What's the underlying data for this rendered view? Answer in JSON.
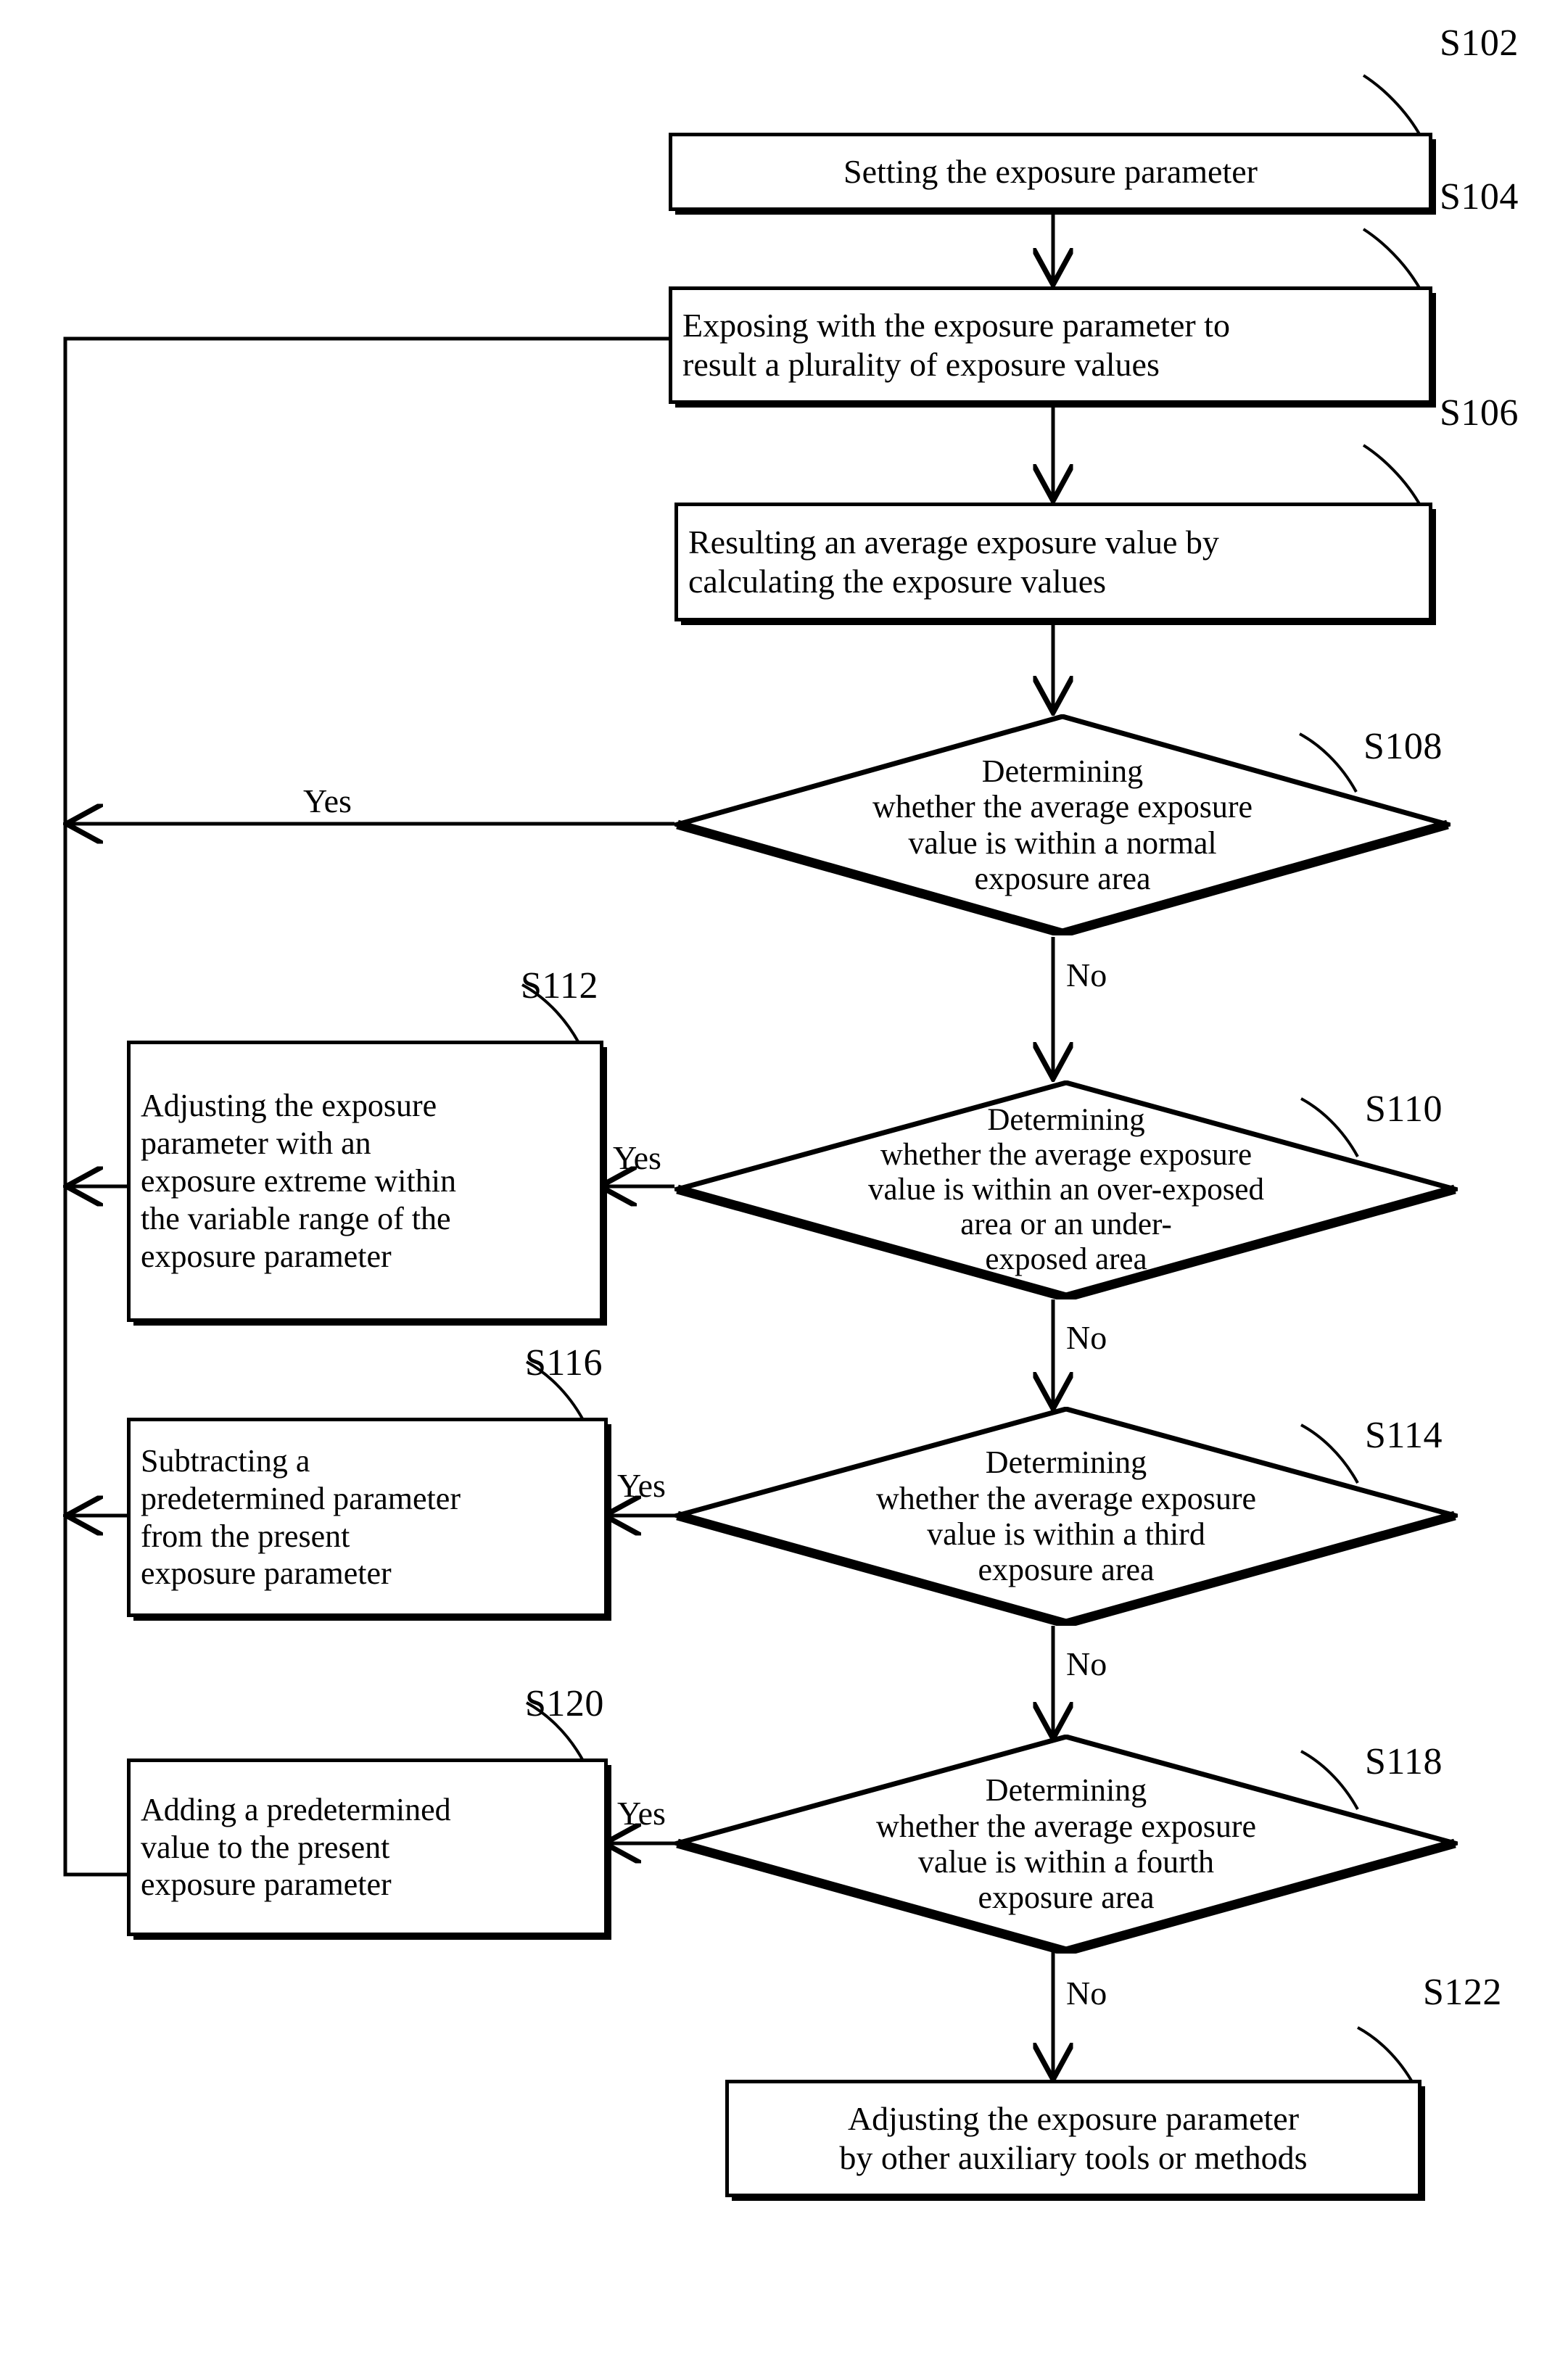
{
  "diagram": {
    "type": "flowchart",
    "title": "Exposure parameter adjustment flowchart",
    "nodes": [
      {
        "id": "S102",
        "ref": "S102",
        "shape": "process",
        "text": "Setting the exposure parameter"
      },
      {
        "id": "S104",
        "ref": "S104",
        "shape": "process",
        "line1": "Exposing with the exposure parameter to",
        "line2": "result a plurality of exposure values"
      },
      {
        "id": "S106",
        "ref": "S106",
        "shape": "process",
        "line1": "Resulting an average exposure value by",
        "line2": "calculating the exposure values"
      },
      {
        "id": "S108",
        "ref": "S108",
        "shape": "decision",
        "line1": "Determining",
        "line2": "whether the average exposure",
        "line3": "value is within a normal",
        "line4": "exposure area"
      },
      {
        "id": "S110",
        "ref": "S110",
        "shape": "decision",
        "line1": "Determining",
        "line2": "whether the average exposure",
        "line3": "value is within an over-exposed",
        "line4": "area or an under-",
        "line5": "exposed area"
      },
      {
        "id": "S112",
        "ref": "S112",
        "shape": "process",
        "line1": "Adjusting the exposure",
        "line2": "parameter with an",
        "line3": "exposure extreme within",
        "line4": "the variable range of the",
        "line5": "exposure parameter"
      },
      {
        "id": "S114",
        "ref": "S114",
        "shape": "decision",
        "line1": "Determining",
        "line2": "whether the average exposure",
        "line3": "value is within a third",
        "line4": "exposure area"
      },
      {
        "id": "S116",
        "ref": "S116",
        "shape": "process",
        "line1": "Subtracting a",
        "line2": "predetermined parameter",
        "line3": "from the present",
        "line4": "exposure parameter"
      },
      {
        "id": "S118",
        "ref": "S118",
        "shape": "decision",
        "line1": "Determining",
        "line2": "whether the average exposure",
        "line3": "value is within a fourth",
        "line4": "exposure area"
      },
      {
        "id": "S120",
        "ref": "S120",
        "shape": "process",
        "line1": "Adding a predetermined",
        "line2": "value to the present",
        "line3": "exposure parameter"
      },
      {
        "id": "S122",
        "ref": "S122",
        "shape": "process",
        "line1": "Adjusting the exposure parameter",
        "line2": "by other auxiliary tools or methods"
      }
    ],
    "edge_labels": {
      "s108_yes": "Yes",
      "s108_no": "No",
      "s110_yes": "Yes",
      "s110_no": "No",
      "s114_yes": "Yes",
      "s114_no": "No",
      "s118_yes": "Yes",
      "s118_no": "No"
    },
    "colors": {
      "stroke": "#000000",
      "background": "#ffffff"
    }
  }
}
